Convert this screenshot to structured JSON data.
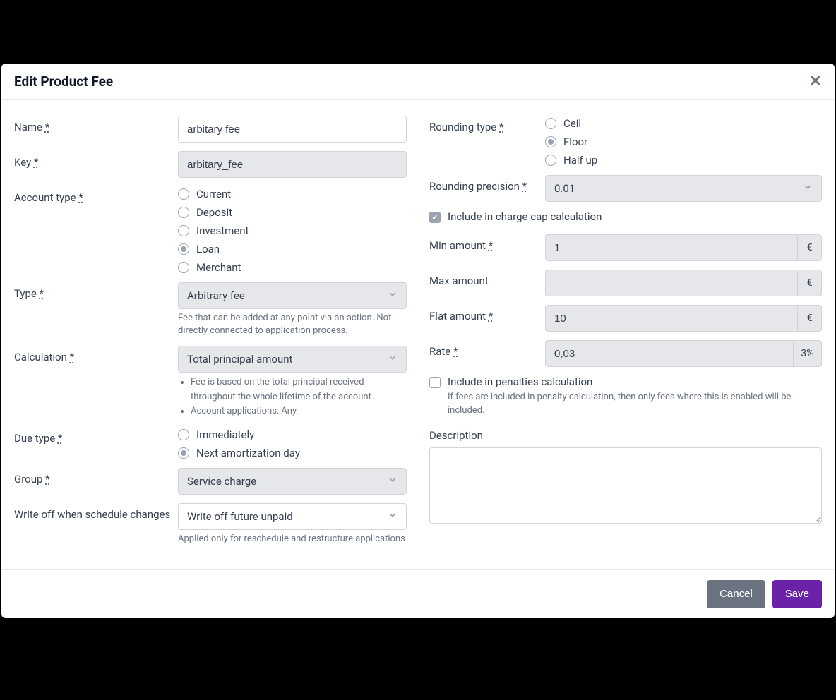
{
  "modal": {
    "title": "Edit Product Fee"
  },
  "left": {
    "name": {
      "label": "Name",
      "req": "*",
      "value": "arbitary fee"
    },
    "key": {
      "label": "Key",
      "req": "*",
      "value": "arbitary_fee"
    },
    "accountType": {
      "label": "Account type",
      "req": "*",
      "options": {
        "current": "Current",
        "deposit": "Deposit",
        "investment": "Investment",
        "loan": "Loan",
        "merchant": "Merchant"
      }
    },
    "type": {
      "label": "Type",
      "req": "*",
      "value": "Arbitrary fee",
      "help": "Fee that can be added at any point via an action. Not directly connected to application process."
    },
    "calculation": {
      "label": "Calculation",
      "req": "*",
      "value": "Total principal amount",
      "help1": "Fee is based on the total principal received throughout the whole lifetime of the account.",
      "help2": "Account applications: Any"
    },
    "dueType": {
      "label": "Due type",
      "req": "*",
      "options": {
        "immediately": "Immediately",
        "nextAmort": "Next amortization day"
      }
    },
    "group": {
      "label": "Group",
      "req": "*",
      "value": "Service charge"
    },
    "writeOff": {
      "label": "Write off when schedule changes",
      "value": "Write off future unpaid",
      "help": "Applied only for reschedule and restructure applications"
    }
  },
  "right": {
    "roundingType": {
      "label": "Rounding type",
      "req": "*",
      "options": {
        "ceil": "Ceil",
        "floor": "Floor",
        "halfup": "Half up"
      }
    },
    "roundingPrecision": {
      "label": "Rounding precision",
      "req": "*",
      "value": "0.01"
    },
    "chargeCap": {
      "label": "Include in charge cap calculation"
    },
    "minAmount": {
      "label": "Min amount",
      "req": "*",
      "value": "1",
      "unit": "€"
    },
    "maxAmount": {
      "label": "Max amount",
      "value": "",
      "unit": "€"
    },
    "flatAmount": {
      "label": "Flat amount",
      "req": "*",
      "value": "10",
      "unit": "€"
    },
    "rate": {
      "label": "Rate",
      "req": "*",
      "value": "0,03",
      "unit": "3%"
    },
    "penalties": {
      "label": "Include in penalties calculation",
      "help": "If fees are included in penalty calculation, then only fees where this is enabled will be included."
    },
    "description": {
      "label": "Description",
      "value": ""
    }
  },
  "footer": {
    "cancel": "Cancel",
    "save": "Save"
  }
}
